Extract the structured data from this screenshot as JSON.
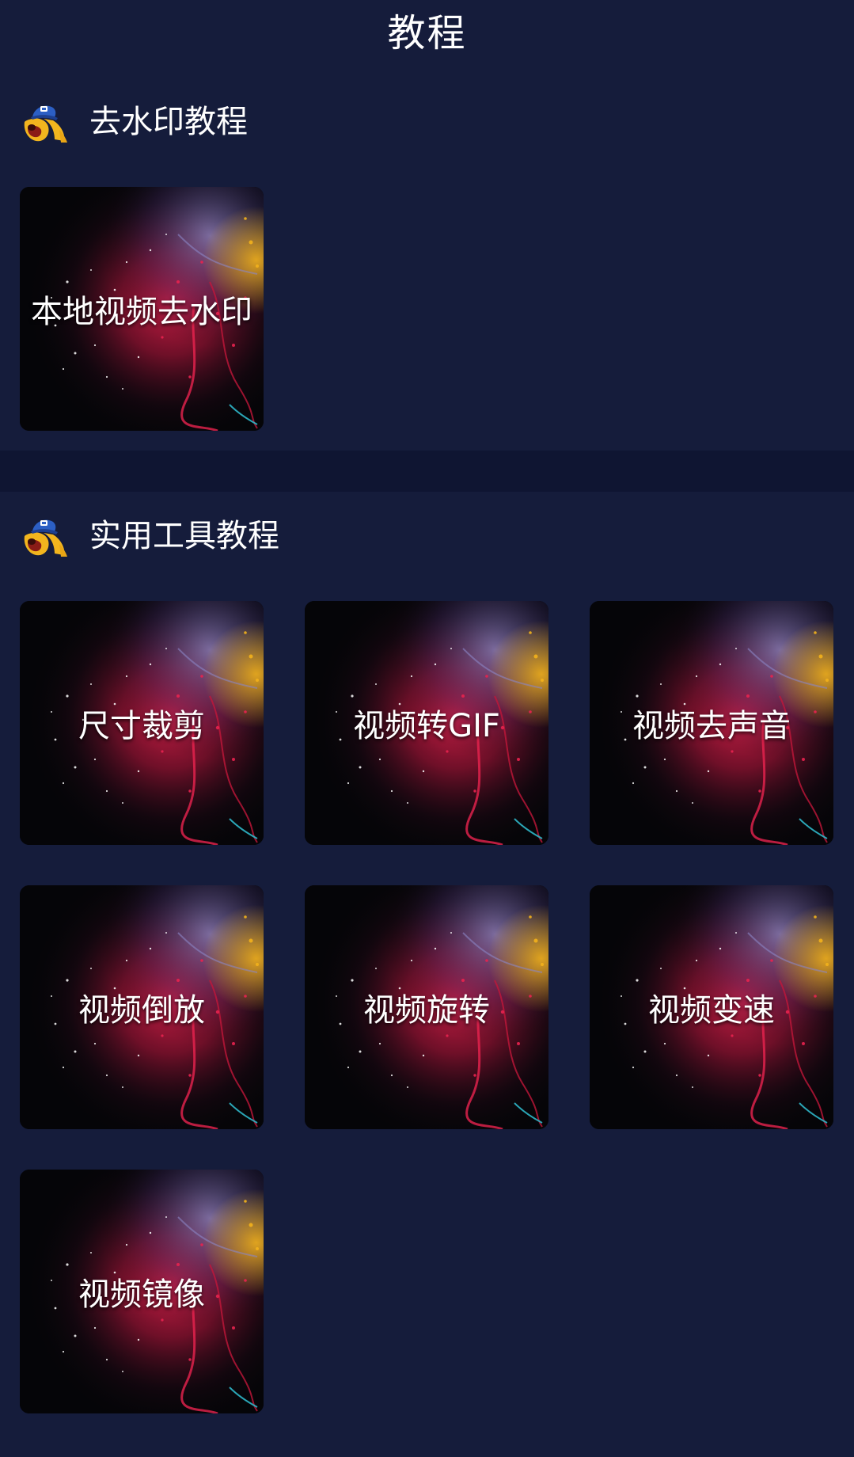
{
  "page": {
    "title": "教程",
    "background_color": "#151c3b",
    "divider_color": "#0f1532"
  },
  "sections": [
    {
      "title": "去水印教程",
      "icon": "mascot-icon",
      "items": [
        {
          "label": "本地视频去水印"
        }
      ]
    },
    {
      "title": "实用工具教程",
      "icon": "mascot-icon",
      "items": [
        {
          "label": "尺寸裁剪"
        },
        {
          "label": "视频转GIF"
        },
        {
          "label": "视频去声音"
        },
        {
          "label": "视频倒放"
        },
        {
          "label": "视频旋转"
        },
        {
          "label": "视频变速"
        },
        {
          "label": "视频镜像"
        }
      ]
    }
  ],
  "card_style": {
    "thumbnail": "color-explosion-thumbnail",
    "accent_colors": [
      "#e8234f",
      "#c0163a",
      "#f3b21c",
      "#2fb7c9",
      "#8a86c4"
    ]
  }
}
